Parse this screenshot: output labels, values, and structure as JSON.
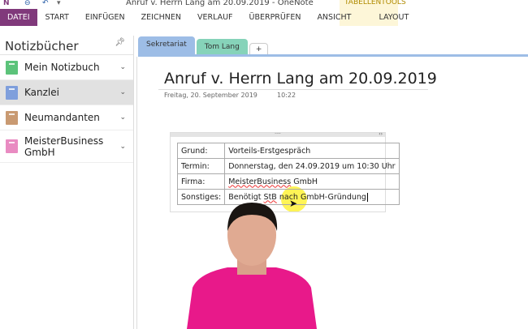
{
  "window": {
    "title": "Anruf v. Herrn Lang am 20.09.2019 - OneNote",
    "contextual_group": "TABELLENTOOLS"
  },
  "ribbon": {
    "tabs": [
      "DATEI",
      "START",
      "EINFÜGEN",
      "ZEICHNEN",
      "VERLAUF",
      "ÜBERPRÜFEN",
      "ANSICHT",
      "LAYOUT"
    ]
  },
  "sidebar": {
    "title": "Notizbücher",
    "notebooks": [
      {
        "label": "Mein Notizbuch",
        "color": "#5cc37a"
      },
      {
        "label": "Kanzlei",
        "color": "#7f9fdc",
        "selected": true
      },
      {
        "label": "Neumandanten",
        "color": "#c99a72"
      },
      {
        "label": "MeisterBusiness GmbH",
        "color": "#e98bc2"
      }
    ]
  },
  "sections": [
    {
      "label": "Sekretariat",
      "color": "#9dbde6"
    },
    {
      "label": "Tom Lang",
      "color": "#86d3b9"
    },
    {
      "label": "+"
    }
  ],
  "page": {
    "title": "Anruf v. Herrn Lang am 20.09.2019",
    "date": "Freitag, 20. September 2019",
    "time": "10:22",
    "table": [
      {
        "key": "Grund:",
        "value": "Vorteils-Erstgespräch"
      },
      {
        "key": "Termin:",
        "value": "Donnerstag, den 24.09.2019 um 10:30 Uhr"
      },
      {
        "key": "Firma:",
        "value_a": "MeisterBusiness",
        "value_b": " GmbH"
      },
      {
        "key": "Sonstiges:",
        "value_a": "Benötigt ",
        "value_b": "StB",
        "value_c": " nach GmbH-Gründung"
      }
    ]
  }
}
